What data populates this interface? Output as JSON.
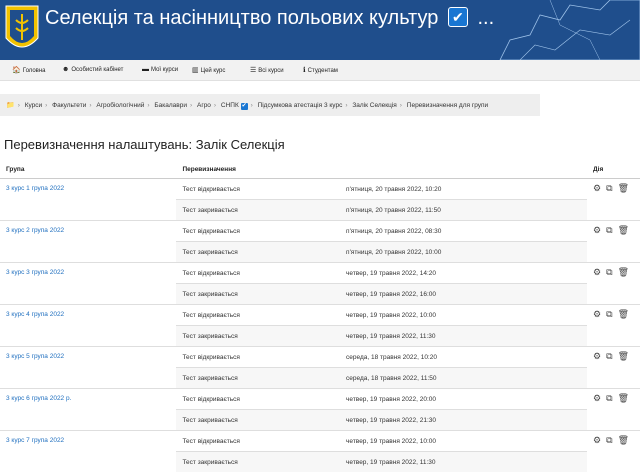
{
  "site": {
    "title": "Селекція та насінництво польових культур",
    "title_suffix": "..."
  },
  "nav": [
    {
      "icon": "home-icon",
      "label": "Головна"
    },
    {
      "icon": "dashboard-icon",
      "label": "Особистий кабінет"
    },
    {
      "icon": "courses-icon",
      "label": "Мої курси"
    },
    {
      "icon": "chart-icon",
      "label": "Цей курс"
    },
    {
      "icon": "list-icon",
      "label": "Всі курси"
    },
    {
      "icon": "info-icon",
      "label": "Студентам"
    }
  ],
  "breadcrumb": [
    "Курси",
    "Факультети",
    "Агробіологічний",
    "Бакалаври",
    "Агро",
    "СНПК",
    "Підсумкова атестація 3 курс",
    "Залік Селекція",
    "Перевизначення для групи"
  ],
  "page": {
    "title": "Перевизначення налаштувань: Залік Селекція"
  },
  "table": {
    "headers": {
      "group": "Група",
      "overrides": "Перевизначення",
      "actions": "Дія"
    },
    "rows": [
      {
        "group": "3 курс 1 група 2022",
        "open_label": "Тест відкривається",
        "open_time": "п'ятниця, 20 травня 2022, 10:20",
        "close_label": "Тест закривається",
        "close_time": "п'ятниця, 20 травня 2022, 11:50"
      },
      {
        "group": "3 курс 2 група 2022",
        "open_label": "Тест відкривається",
        "open_time": "п'ятниця, 20 травня 2022, 08:30",
        "close_label": "Тест закривається",
        "close_time": "п'ятниця, 20 травня 2022, 10:00"
      },
      {
        "group": "3 курс 3 група 2022",
        "open_label": "Тест відкривається",
        "open_time": "четвер, 19 травня 2022, 14:20",
        "close_label": "Тест закривається",
        "close_time": "четвер, 19 травня 2022, 16:00"
      },
      {
        "group": "3 курс 4 група 2022",
        "open_label": "Тест відкривається",
        "open_time": "четвер, 19 травня 2022, 10:00",
        "close_label": "Тест закривається",
        "close_time": "четвер, 19 травня 2022, 11:30"
      },
      {
        "group": "3 курс 5 група 2022",
        "open_label": "Тест відкривається",
        "open_time": "середа, 18 травня 2022, 10:20",
        "close_label": "Тест закривається",
        "close_time": "середа, 18 травня 2022, 11:50"
      },
      {
        "group": "3 курс 6 група 2022 р.",
        "open_label": "Тест відкривається",
        "open_time": "четвер, 19 травня 2022, 20:00",
        "close_label": "Тест закривається",
        "close_time": "четвер, 19 травня 2022, 21:30"
      },
      {
        "group": "3 курс 7 група 2022",
        "open_label": "Тест відкривається",
        "open_time": "четвер, 19 травня 2022, 10:00",
        "close_label": "Тест закривається",
        "close_time": "четвер, 19 травня 2022, 11:30"
      }
    ],
    "action_icons": [
      "gear-icon",
      "copy-icon",
      "trash-icon"
    ]
  },
  "colors": {
    "banner": "#1f4e8c",
    "link": "#1f6fbf",
    "checkbox": "#1976d2"
  }
}
